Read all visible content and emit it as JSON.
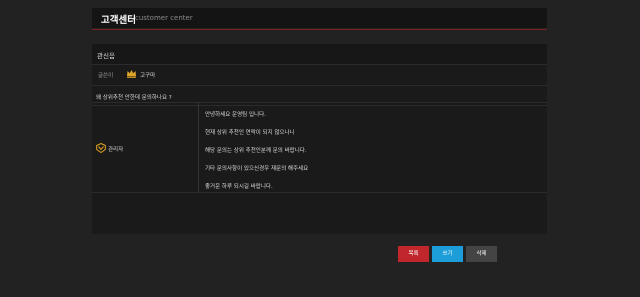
{
  "header": {
    "title": "고객센터",
    "subtitle": "customer center"
  },
  "post": {
    "category": "관신음",
    "author_label": "글쓴이",
    "author_name": "고구마",
    "question": "왜 상위추천 안한데 문의하나요 ?",
    "answer_author": "관리자",
    "answer_lines": [
      "안녕하세요 운영팀 입니다.",
      "현재 상위 추천인 연락이 되지 않으나니",
      "해당 문의는 상위 추천인분께 문의 바랍니다.",
      "기타 문의사항이 있으신경우 재문의 해주세요",
      "좋거운 하루 되시길 바랍니다."
    ]
  },
  "buttons": {
    "list": "목록",
    "write": "쓰기",
    "delete": "삭제"
  },
  "colors": {
    "accent_red": "#c0272d",
    "accent_blue": "#1e9ed8",
    "crown": "#e0a526"
  },
  "icons": {
    "author": "crown-icon",
    "admin": "admin-badge-icon"
  }
}
